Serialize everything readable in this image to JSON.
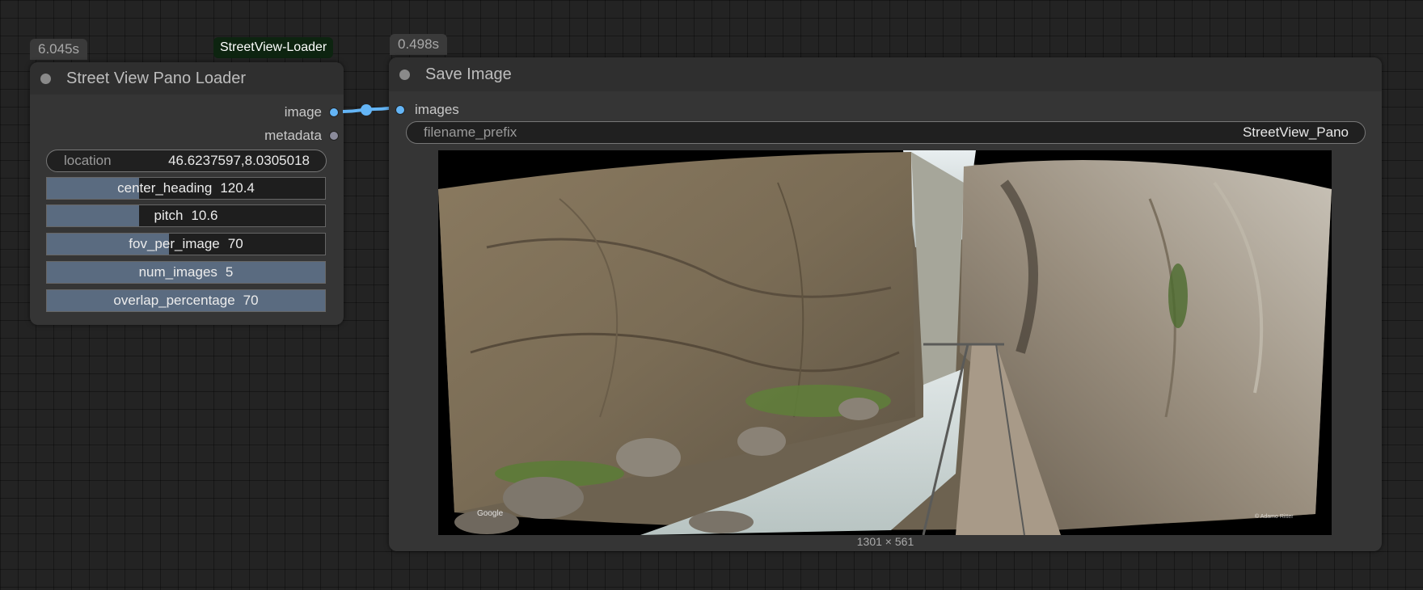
{
  "loader": {
    "timing": "6.045s",
    "badge": "StreetView-Loader",
    "title": "Street View Pano Loader",
    "outputs": [
      {
        "name": "image",
        "color": "#64b5f6"
      },
      {
        "name": "metadata",
        "color": "#8a8a9a"
      }
    ],
    "location": {
      "label": "location",
      "value": "46.6237597,8.0305018"
    },
    "sliders": [
      {
        "label": "center_heading",
        "value": "120.4",
        "fill_fraction": 0.33
      },
      {
        "label": "pitch",
        "value": "10.6",
        "fill_fraction": 0.33
      },
      {
        "label": "fov_per_image",
        "value": "70",
        "fill_fraction": 0.44
      },
      {
        "label": "num_images",
        "value": "5",
        "fill_fraction": 1.0
      },
      {
        "label": "overlap_percentage",
        "value": "70",
        "fill_fraction": 1.0
      }
    ]
  },
  "save": {
    "timing": "0.498s",
    "title": "Save Image",
    "input": {
      "name": "images",
      "color": "#64b5f6"
    },
    "filename_prefix": {
      "label": "filename_prefix",
      "value": "StreetView_Pano"
    },
    "image_dims": "1301 × 561",
    "watermark_left": "Google",
    "watermark_right": "© Adamo Ritter"
  },
  "link_color": "#64b5f6"
}
